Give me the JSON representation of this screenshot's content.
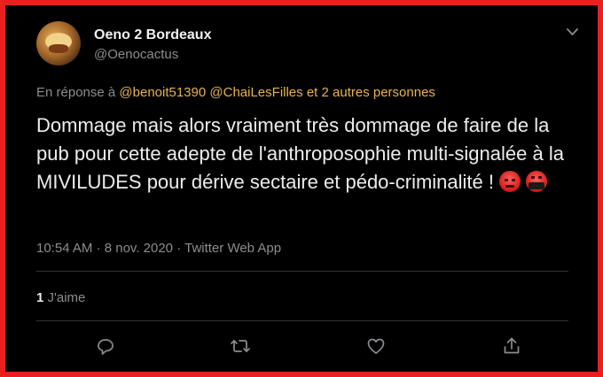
{
  "tweet": {
    "display_name": "Oeno 2 Bordeaux",
    "handle": "@Oenocactus",
    "reply_prefix": "En réponse à",
    "reply_mentions": [
      "@benoit51390",
      "@ChaiLesFilles"
    ],
    "reply_suffix": "et 2 autres personnes",
    "text": "Dommage mais alors vraiment très dommage de faire de la pub pour cette adepte de l'anthroposophie multi-signalée à la MIVILUDES pour dérive sectaire et pédo-criminalité !",
    "time": "10:54 AM",
    "separator": "·",
    "date": "8 nov. 2020",
    "source": "Twitter Web App",
    "likes_count": "1",
    "likes_label": "J'aime"
  },
  "icons": {
    "more": "chevron-down-icon",
    "reply": "reply-icon",
    "retweet": "retweet-icon",
    "like": "heart-icon",
    "share": "share-icon",
    "emoji1": "angry-face-emoji",
    "emoji2": "cursing-face-emoji"
  },
  "colors": {
    "frame": "#e8201f",
    "background": "#000000",
    "mention": "#e8b44d",
    "secondary": "#8a8d91"
  }
}
